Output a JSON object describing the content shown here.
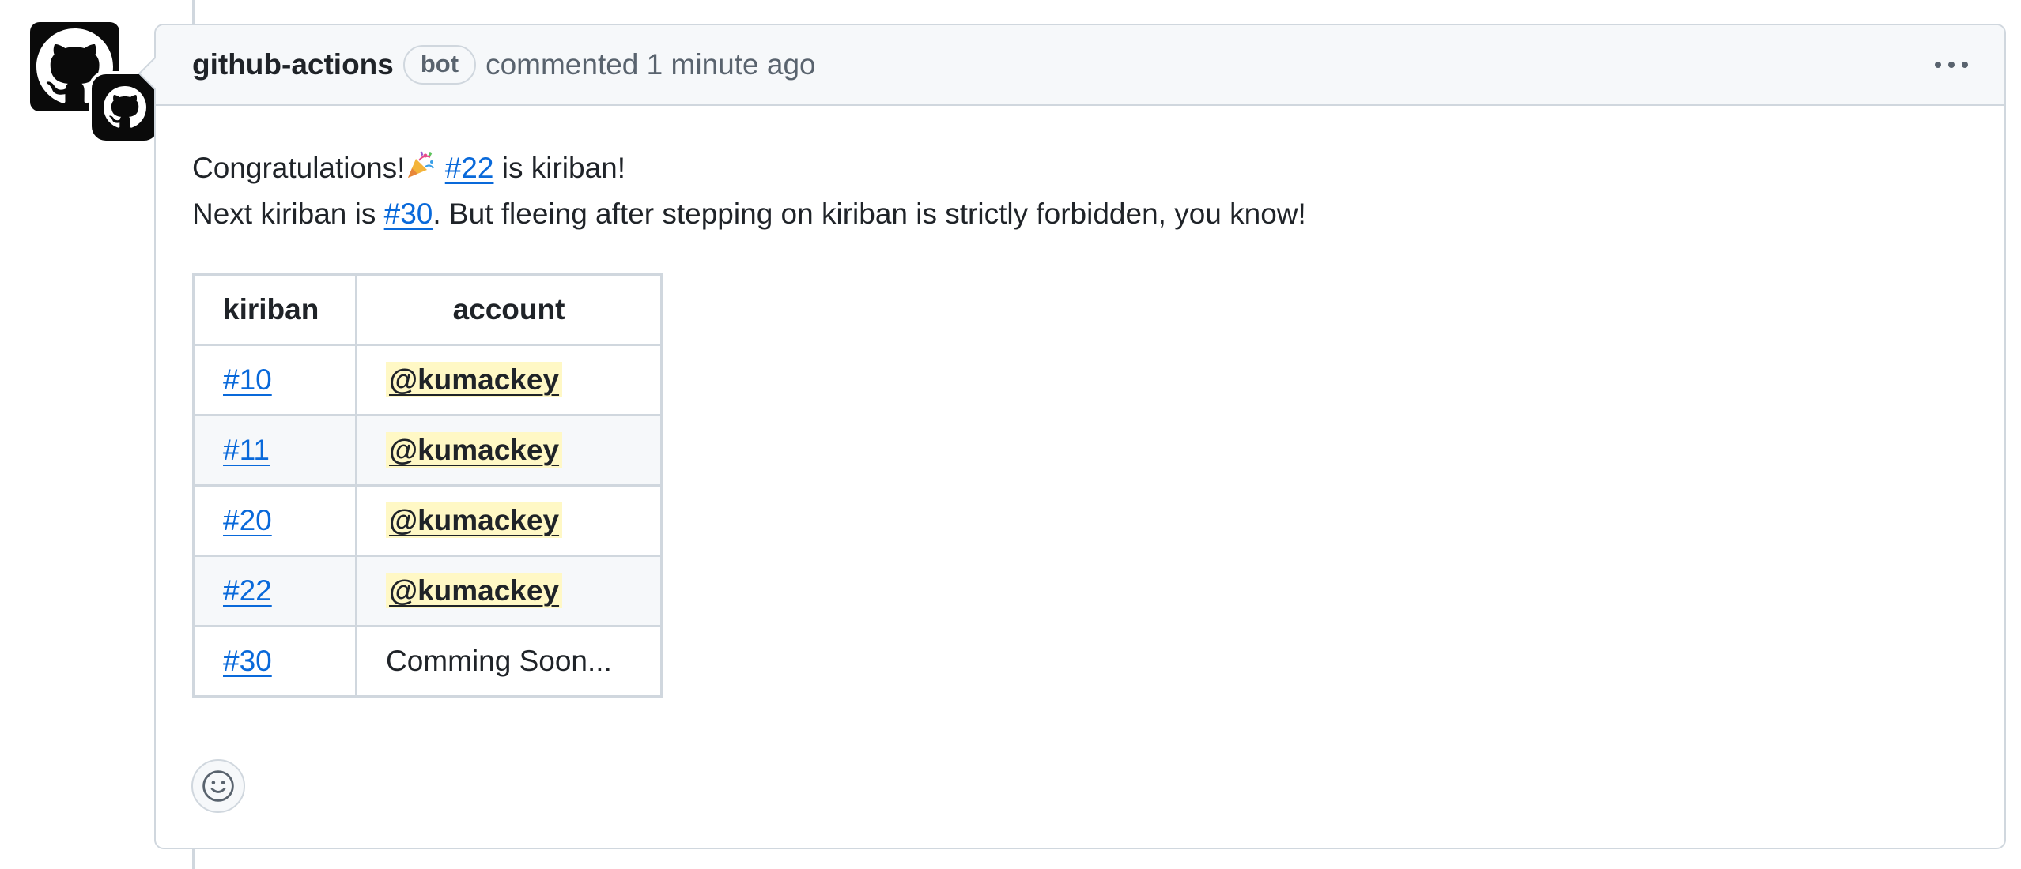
{
  "comment": {
    "author": "github-actions",
    "badge": "bot",
    "meta_text": "commented 1 minute ago",
    "line1": {
      "before": "Congratulations!",
      "emoji": "party-popper-icon",
      "link": "#22",
      "after": " is kiriban!"
    },
    "line2": {
      "before": "Next kiriban is ",
      "link": "#30",
      "after": ". But fleeing after stepping on kiriban is strictly forbidden, you know!"
    },
    "table": {
      "headers": [
        "kiriban",
        "account"
      ],
      "rows": [
        {
          "kiriban": "#10",
          "account": "@kumackey"
        },
        {
          "kiriban": "#11",
          "account": "@kumackey"
        },
        {
          "kiriban": "#20",
          "account": "@kumackey"
        },
        {
          "kiriban": "#22",
          "account": "@kumackey"
        },
        {
          "kiriban": "#30",
          "account": "Comming Soon..."
        }
      ]
    }
  },
  "icons": {
    "avatar": "github-mark-icon",
    "menu": "kebab-menu-icon",
    "reaction": "smiley-icon"
  },
  "colors": {
    "link": "#0969da",
    "mention_bg": "#fff8c5",
    "border": "#d0d7de",
    "header_bg": "#f6f8fa",
    "muted": "#59636e"
  }
}
